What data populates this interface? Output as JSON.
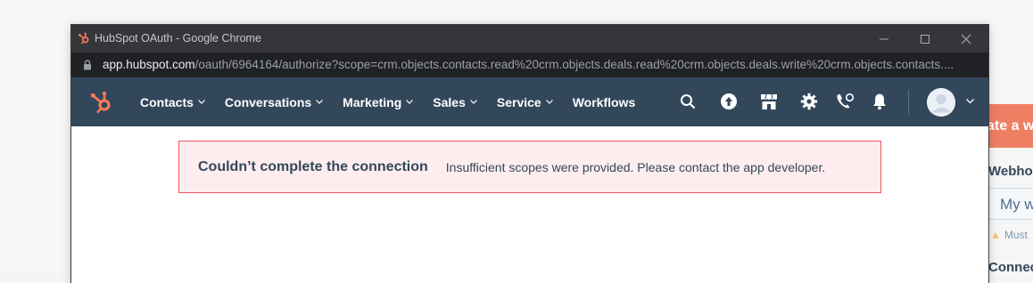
{
  "window": {
    "title": "HubSpot OAuth - Google Chrome",
    "url_host": "app.hubspot.com",
    "url_path": "/oauth/6964164/authorize?scope=crm.objects.contacts.read%20crm.objects.deals.read%20crm.objects.deals.write%20crm.objects.contacts...."
  },
  "nav": {
    "items": [
      {
        "label": "Contacts",
        "dropdown": true
      },
      {
        "label": "Conversations",
        "dropdown": true
      },
      {
        "label": "Marketing",
        "dropdown": true
      },
      {
        "label": "Sales",
        "dropdown": true
      },
      {
        "label": "Service",
        "dropdown": true
      },
      {
        "label": "Workflows",
        "dropdown": false
      }
    ],
    "icons": [
      "search-icon",
      "upgrade-icon",
      "marketplace-icon",
      "settings-icon",
      "calling-icon",
      "notifications-icon"
    ]
  },
  "alert": {
    "title": "Couldn’t complete the connection",
    "message": "Insufficient scopes were provided. Please contact the app developer."
  },
  "background": {
    "cta_label": "ate a w",
    "field_label": "Webhoo",
    "input_value": "My w",
    "warning_text": "Must",
    "section_label": "Connec"
  },
  "colors": {
    "nav_bg": "#33475b",
    "alert_bg": "#fdedee",
    "alert_border": "#f2545b",
    "hubspot_orange": "#ff7a59"
  }
}
